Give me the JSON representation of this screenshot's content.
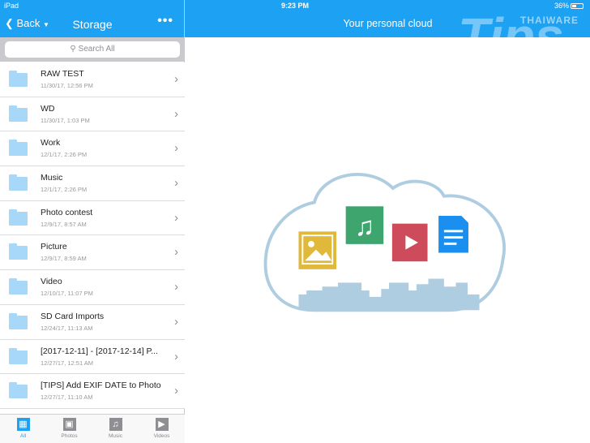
{
  "status": {
    "device": "iPad",
    "time": "9:23 PM",
    "battery": "36%",
    "battery_level": 0.36
  },
  "nav": {
    "back": "Back",
    "title": "Storage",
    "more": "•••"
  },
  "search": {
    "placeholder": "Search All"
  },
  "folders": [
    {
      "name": "RAW TEST",
      "date": "11/30/17, 12:56 PM"
    },
    {
      "name": "WD",
      "date": "11/30/17, 1:03 PM"
    },
    {
      "name": "Work",
      "date": "12/1/17, 2:26 PM"
    },
    {
      "name": "Music",
      "date": "12/1/17, 2:26 PM"
    },
    {
      "name": "Photo contest",
      "date": "12/9/17, 8:57 AM"
    },
    {
      "name": "Picture",
      "date": "12/9/17, 8:59 AM"
    },
    {
      "name": "Video",
      "date": "12/10/17, 11:07 PM"
    },
    {
      "name": "SD Card Imports",
      "date": "12/24/17, 11:13 AM"
    },
    {
      "name": "[2017-12-11] - [2017-12-14] P...",
      "date": "12/27/17, 12:51 AM"
    },
    {
      "name": "[TIPS] Add EXIF DATE to Photo",
      "date": "12/27/17, 11:10 AM"
    }
  ],
  "tabs": [
    {
      "label": "All",
      "icon": "grid-icon"
    },
    {
      "label": "Photos",
      "icon": "photo-icon"
    },
    {
      "label": "Music",
      "icon": "music-icon"
    },
    {
      "label": "Videos",
      "icon": "video-icon"
    }
  ],
  "right": {
    "title": "Your personal cloud"
  },
  "watermark": {
    "brand": "THAIWARE",
    "logo": "Tips"
  },
  "colors": {
    "accent": "#1da1f2"
  }
}
